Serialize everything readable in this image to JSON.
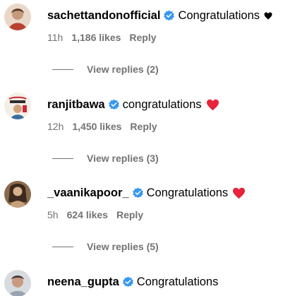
{
  "comments": [
    {
      "username": "sachettandonofficial",
      "text": "Congratulations",
      "emoji": "black-heart",
      "time": "11h",
      "likes": "1,186 likes",
      "reply_label": "Reply",
      "view_replies": "View replies (2)"
    },
    {
      "username": "ranjitbawa",
      "text": "congratulations",
      "emoji": "red-heart",
      "time": "12h",
      "likes": "1,450 likes",
      "reply_label": "Reply",
      "view_replies": "View replies (3)"
    },
    {
      "username": "_vaanikapoor_",
      "text": "Congratulations",
      "emoji": "red-heart",
      "time": "5h",
      "likes": "624 likes",
      "reply_label": "Reply",
      "view_replies": "View replies (5)"
    },
    {
      "username": "neena_gupta",
      "text": "Congratulations"
    }
  ],
  "colors": {
    "verified_badge": "#3897f0",
    "meta_text": "#737373",
    "red_heart": "#e8233b",
    "black_heart": "#000000"
  }
}
